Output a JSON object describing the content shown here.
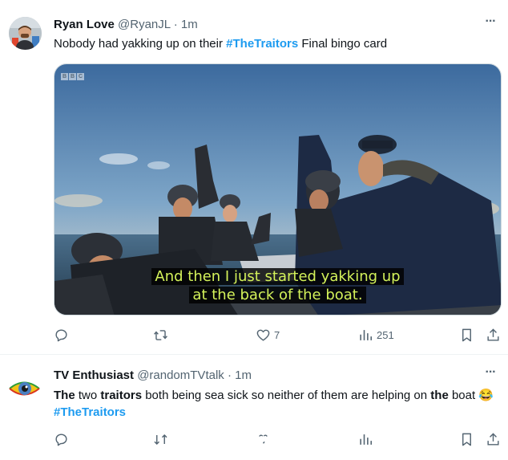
{
  "tweets": [
    {
      "author": {
        "display_name": "Ryan Love",
        "handle": "@RyanJL"
      },
      "separator": "·",
      "time": "1m",
      "more_icon": "more-horizontal-icon",
      "text": {
        "before": "Nobody had yakking up on their ",
        "hashtag": "#TheTraitors",
        "after": " Final bingo card"
      },
      "media": {
        "watermark": [
          "B",
          "B",
          "C"
        ],
        "subtitle_line_1": "And then I just started yakking up",
        "subtitle_line_2": "at the back of the boat."
      },
      "actions": {
        "reply": {
          "icon": "reply-icon",
          "count": ""
        },
        "retweet": {
          "icon": "retweet-icon",
          "count": ""
        },
        "like": {
          "icon": "heart-icon",
          "count": "7"
        },
        "views": {
          "icon": "views-icon",
          "count": "251"
        },
        "bookmark": {
          "icon": "bookmark-icon"
        },
        "share": {
          "icon": "share-icon"
        }
      }
    },
    {
      "author": {
        "display_name": "TV Enthusiast",
        "handle": "@randomTVtalk"
      },
      "separator": "·",
      "time": "1m",
      "more_icon": "more-horizontal-icon",
      "text": {
        "w1": "The",
        "w2": " two ",
        "w3": "traitors",
        "w4": " both being sea sick so neither of them are helping on ",
        "w5": "the",
        "w6": " boat ",
        "emoji": "😂",
        "w7": " ",
        "hashtag": "#TheTraitors"
      },
      "actions": {
        "reply": {
          "icon": "reply-icon",
          "count": ""
        },
        "retweet": {
          "icon": "retweet-icon",
          "count": ""
        },
        "like": {
          "icon": "heart-icon",
          "count": ""
        },
        "views": {
          "icon": "views-icon",
          "count": ""
        },
        "bookmark": {
          "icon": "bookmark-icon"
        },
        "share": {
          "icon": "share-icon"
        }
      }
    }
  ],
  "colors": {
    "accent": "#1d9bf0",
    "text_primary": "#0f1419",
    "text_secondary": "#536471",
    "subtitle": "#d4f25a"
  }
}
